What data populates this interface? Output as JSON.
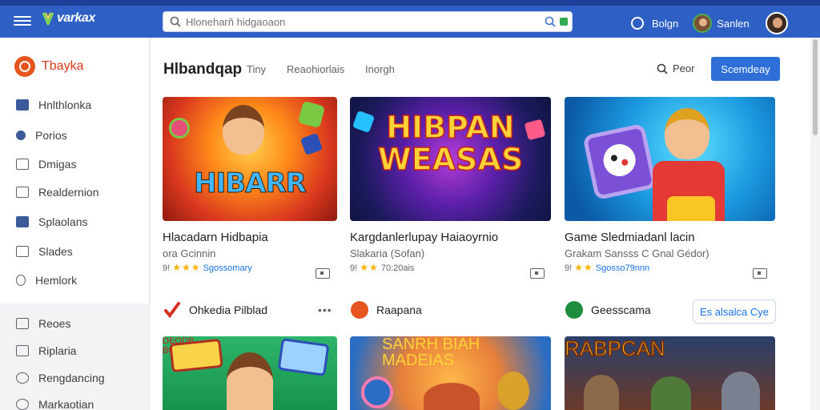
{
  "topbar": {
    "app_name": "varkax",
    "search_placeholder": "Hloneharñ hidgaoaon",
    "link_label": "Bolgn",
    "user_label": "Sanlen"
  },
  "sidebar": {
    "brand": "Tbayka",
    "items": [
      {
        "label": "Hnlthlonka",
        "icon": "home-icon"
      },
      {
        "label": "Porios",
        "icon": "pin-icon"
      },
      {
        "label": "Dmigas",
        "icon": "document-icon"
      },
      {
        "label": "Realdernion",
        "icon": "calendar-icon"
      },
      {
        "label": "Splaolans",
        "icon": "chart-icon"
      },
      {
        "label": "Slades",
        "icon": "plus-box-icon"
      },
      {
        "label": "Hemlork",
        "icon": "bulb-icon"
      }
    ],
    "lower_items": [
      {
        "label": "Reoes",
        "icon": "box-icon"
      },
      {
        "label": "Riplaria",
        "icon": "lock-icon"
      },
      {
        "label": "Rengdancing",
        "icon": "clock-icon"
      },
      {
        "label": "Markaotian",
        "icon": "target-icon"
      }
    ]
  },
  "main": {
    "title": "Hlbandqap",
    "tabs": [
      "Tiny",
      "Reaohiorlais",
      "Inorgh"
    ],
    "sort_label": "Peor",
    "primary_button": "Scemdeay",
    "cards": [
      {
        "title": "Hlacadarn Hidbapia",
        "subtitle": "ora Gcinnin",
        "meta_prefix": "9!",
        "meta_link": "Sgossomary",
        "image_text": "HIBARR"
      },
      {
        "title": "Kargdanlerlupay Haiaoyrnio",
        "subtitle": "Slakaria (Sofan)",
        "meta_prefix": "9!",
        "meta_link": "70:20ais",
        "image_text": "HIBPAN WEASAS"
      },
      {
        "title": "Game Sledmiadanl lacin",
        "subtitle": "Grakam Sansss C Gnal Gédor)",
        "meta_prefix": "9!",
        "meta_link": "Sgosso79nnn",
        "image_text": ""
      }
    ],
    "sections": [
      {
        "label": "Ohkedia Pilblad",
        "color": "#d93025"
      },
      {
        "label": "Raapana",
        "color": "#e8541e"
      },
      {
        "label": "Geesscama",
        "color": "#1e8e3e"
      }
    ],
    "section_button": "Es alsalca Cye",
    "bottom_cards": [
      {
        "image_text": "DEODB BULUCHIZI"
      },
      {
        "image_text": "SANRH BIAH MADEIAS"
      },
      {
        "image_text": "RABPCAN"
      }
    ]
  },
  "colors": {
    "topbar": "#2d5fc4",
    "accent": "#2d6fd6",
    "brand": "#e8541e",
    "link": "#1a73e8",
    "star": "#f4b400"
  }
}
